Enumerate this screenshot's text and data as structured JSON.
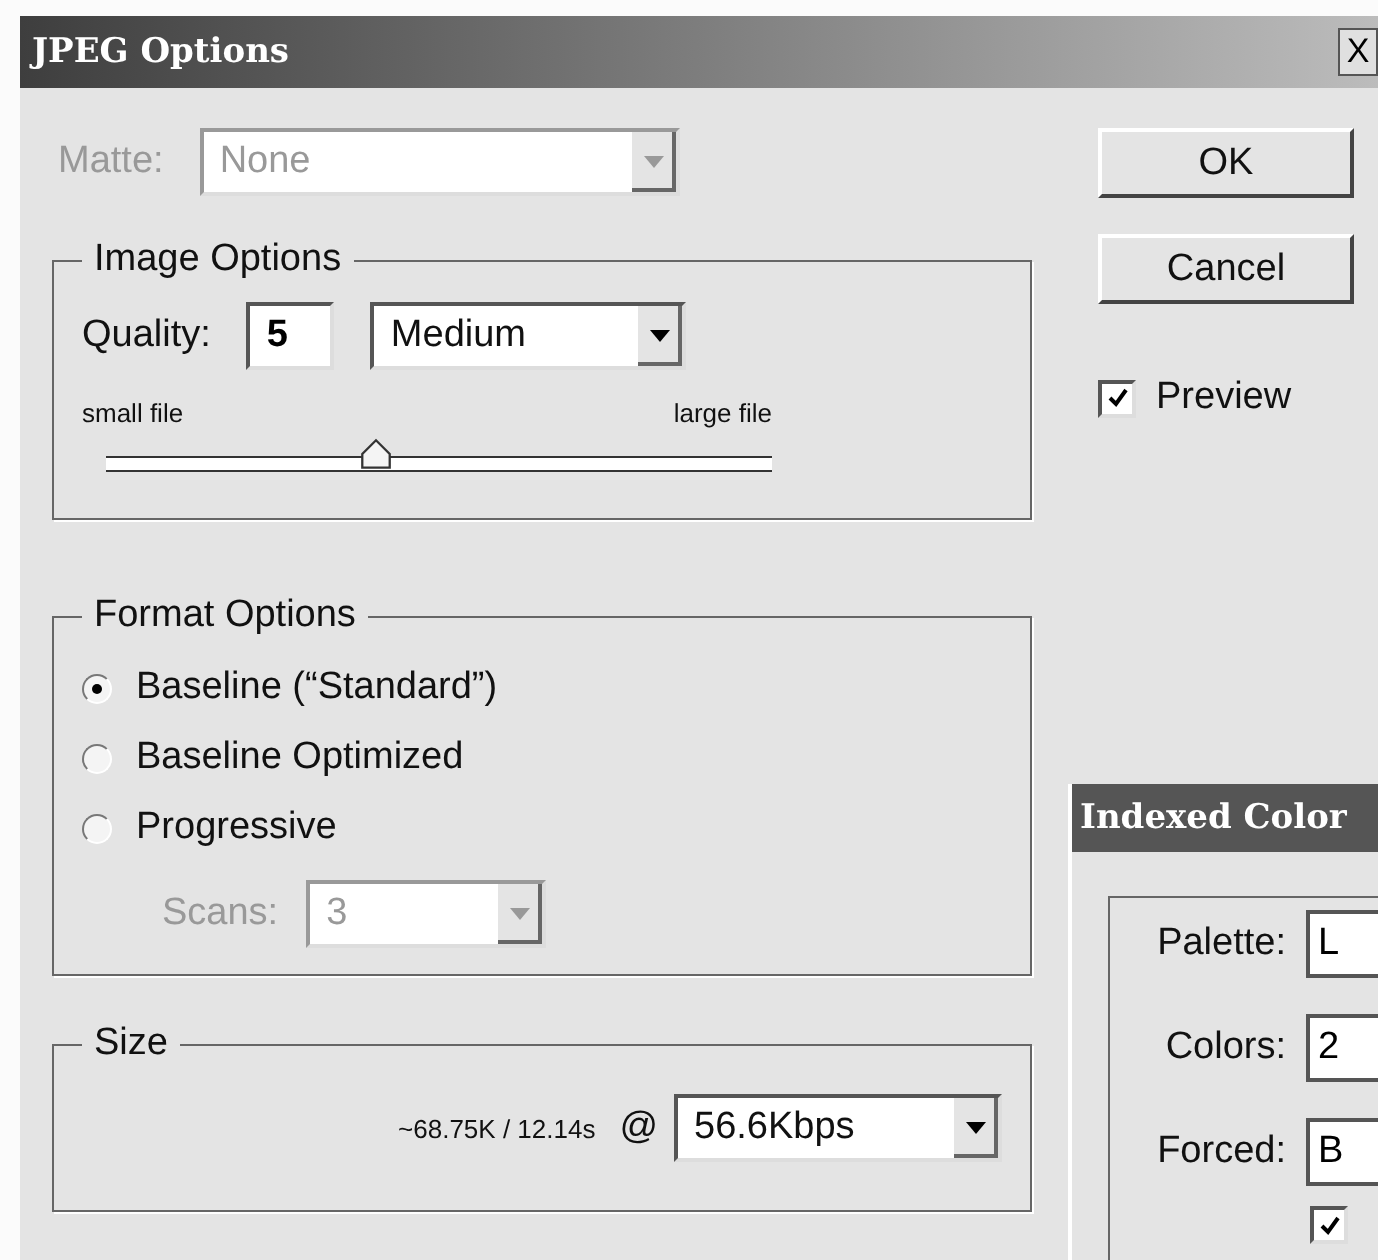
{
  "window": {
    "title": "JPEG Options",
    "close": "X"
  },
  "matte": {
    "label": "Matte:",
    "value": "None",
    "disabled": true
  },
  "image_options": {
    "title": "Image Options",
    "quality": {
      "label": "Quality:",
      "value": "5"
    },
    "preset": {
      "value": "Medium"
    },
    "slider": {
      "min_label": "small file",
      "max_label": "large file",
      "level": 0.41
    }
  },
  "format_options": {
    "title": "Format Options",
    "choices": [
      {
        "label": "Baseline (“Standard”)",
        "selected": true
      },
      {
        "label": "Baseline Optimized",
        "selected": false
      },
      {
        "label": "Progressive",
        "selected": false
      }
    ],
    "scans": {
      "label": "Scans:",
      "value": "3",
      "disabled": true
    }
  },
  "size": {
    "title": "Size",
    "estimate": "~68.75K / 12.14s",
    "at": "@",
    "speed": {
      "value": "56.6Kbps"
    }
  },
  "buttons": [
    {
      "label": "OK"
    },
    {
      "label": "Cancel"
    }
  ],
  "preview": {
    "label": "Preview",
    "checked": true
  },
  "indexed_color": {
    "title": "Indexed Color",
    "fields": [
      {
        "label": "Palette:",
        "value": "L"
      },
      {
        "label": "Colors:",
        "value": "2"
      },
      {
        "label": "Forced:",
        "value": "B"
      }
    ],
    "checkbox": {
      "checked": true
    }
  }
}
